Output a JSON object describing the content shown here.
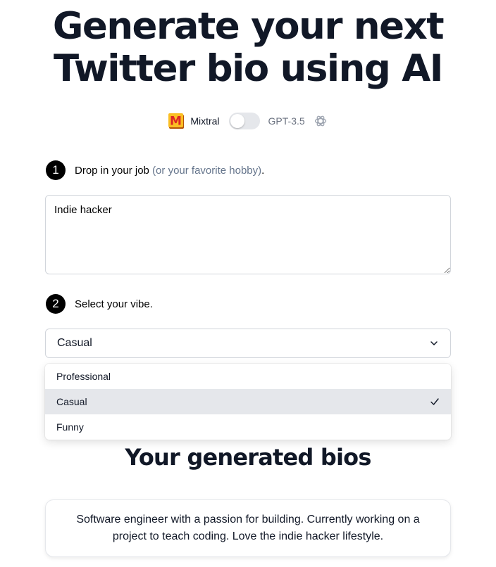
{
  "header": {
    "title_line1": "Generate your next",
    "title_line2": "Twitter bio using AI"
  },
  "model_toggle": {
    "left_label": "Mixtral",
    "right_label": "GPT-3.5",
    "selected": "Mixtral",
    "left_logo_letter": "M",
    "left_icon": "mixtral-logo-icon",
    "right_icon": "openai-logo-icon"
  },
  "step1": {
    "number": "1",
    "text": "Drop in your job",
    "hint": "(or your favorite hobby)",
    "end": "."
  },
  "job_input": {
    "value": "Indie hacker"
  },
  "step2": {
    "number": "2",
    "text": "Select your vibe."
  },
  "vibe_select": {
    "value": "Casual",
    "options": [
      {
        "label": "Professional",
        "selected": false
      },
      {
        "label": "Casual",
        "selected": true
      },
      {
        "label": "Funny",
        "selected": false
      }
    ],
    "chevron_icon": "chevron-down-icon",
    "check_icon": "check-icon"
  },
  "results": {
    "title": "Your generated bios",
    "bios": [
      "Software engineer with a passion for building. Currently working on a project to teach coding. Love the indie hacker lifestyle."
    ]
  },
  "colors": {
    "text_dark": "#111827",
    "hint": "#64748b",
    "toggle_off": "#e5e7eb",
    "selected_option": "#e5e7eb",
    "mixtral_orange": "#f59e0b"
  }
}
